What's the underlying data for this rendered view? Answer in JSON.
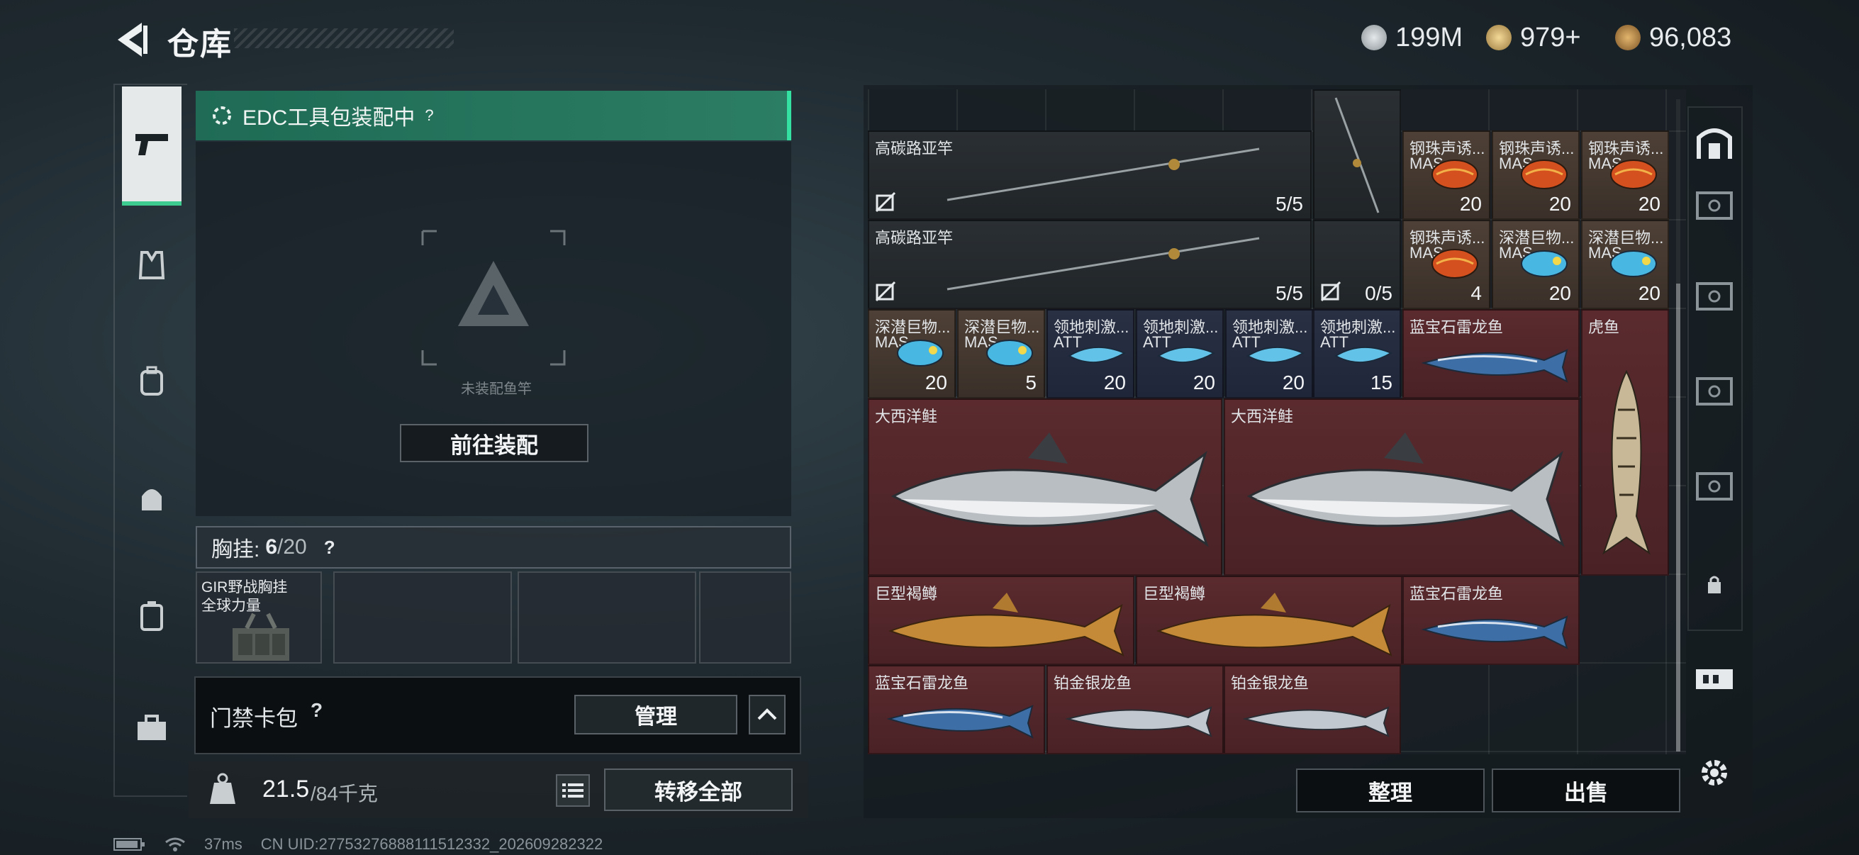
{
  "header": {
    "title": "仓库",
    "currencies": [
      {
        "icon": "silver-coin-icon",
        "value": "199M",
        "color": "#bcc3c7"
      },
      {
        "icon": "gold-token-icon",
        "value": "979+",
        "color": "#d8b36b"
      },
      {
        "icon": "bronze-coin-icon",
        "value": "96,083",
        "color": "#c99a55"
      }
    ]
  },
  "left_nav": {
    "items": [
      {
        "icon": "pistol-icon",
        "active": true
      },
      {
        "icon": "vest-icon",
        "active": false
      },
      {
        "icon": "backpack-icon",
        "active": false
      },
      {
        "icon": "helmet-bag-icon",
        "active": false
      },
      {
        "icon": "case-icon",
        "active": false
      },
      {
        "icon": "toolbox-icon",
        "active": false
      }
    ]
  },
  "equip": {
    "edc_label": "EDC工具包装配中",
    "help": "?",
    "unequipped_label": "未装配鱼竿",
    "goto_label": "前往装配"
  },
  "chest": {
    "label": "胸挂:",
    "count": "6",
    "capacity": "/20",
    "help": "?",
    "slot1_name_line1": "GIR野战胸挂",
    "slot1_name_line2": "全球力量"
  },
  "card_pack": {
    "label": "门禁卡包",
    "help": "?",
    "manage_label": "管理"
  },
  "weight": {
    "current": "21.5",
    "max": "/84千克",
    "icon_text": "KG",
    "transfer_label": "转移全部"
  },
  "grid": {
    "items": [
      {
        "name": "高碳路亚竿",
        "count": "5/5"
      },
      {
        "name": "",
        "count": ""
      },
      {
        "name": "钢珠声诱...",
        "sub": "MAS",
        "count": "20"
      },
      {
        "name": "钢珠声诱...",
        "sub": "MAS",
        "count": "20"
      },
      {
        "name": "钢珠声诱...",
        "sub": "MAS",
        "count": "20"
      },
      {
        "name": "高碳路亚竿",
        "count": "5/5"
      },
      {
        "name": "",
        "count": "0/5"
      },
      {
        "name": "钢珠声诱...",
        "sub": "MAS",
        "count": "4"
      },
      {
        "name": "深潜巨物...",
        "sub": "MAS",
        "count": "20"
      },
      {
        "name": "深潜巨物...",
        "sub": "MAS",
        "count": "20"
      },
      {
        "name": "深潜巨物...",
        "sub": "MAS",
        "count": "20"
      },
      {
        "name": "深潜巨物...",
        "sub": "MAS",
        "count": "5"
      },
      {
        "name": "领地刺激...",
        "sub": "ATT",
        "count": "20"
      },
      {
        "name": "领地刺激...",
        "sub": "ATT",
        "count": "20"
      },
      {
        "name": "领地刺激...",
        "sub": "ATT",
        "count": "20"
      },
      {
        "name": "领地刺激...",
        "sub": "ATT",
        "count": "15"
      },
      {
        "name": "蓝宝石雷龙鱼"
      },
      {
        "name": "虎鱼"
      },
      {
        "name": "大西洋鲑"
      },
      {
        "name": "大西洋鲑"
      },
      {
        "name": "巨型褐鳟"
      },
      {
        "name": "巨型褐鳟"
      },
      {
        "name": "蓝宝石雷龙鱼"
      },
      {
        "name": "蓝宝石雷龙鱼"
      },
      {
        "name": "铂金银龙鱼"
      },
      {
        "name": "铂金银龙鱼"
      }
    ],
    "sort_label": "整理",
    "sell_label": "出售"
  },
  "right_nav": {
    "items": [
      {
        "icon": "vault-door-icon"
      },
      {
        "icon": "safe-box-icon"
      },
      {
        "icon": "safe-box-icon"
      },
      {
        "icon": "safe-box-icon"
      },
      {
        "icon": "safe-box-icon"
      },
      {
        "icon": "lock-icon"
      },
      {
        "icon": "tag-icon"
      },
      {
        "icon": "gear-icon"
      }
    ]
  },
  "status_bar": {
    "ping": "37ms",
    "uid": "CN UID:27753276888111512332_202609282322"
  }
}
